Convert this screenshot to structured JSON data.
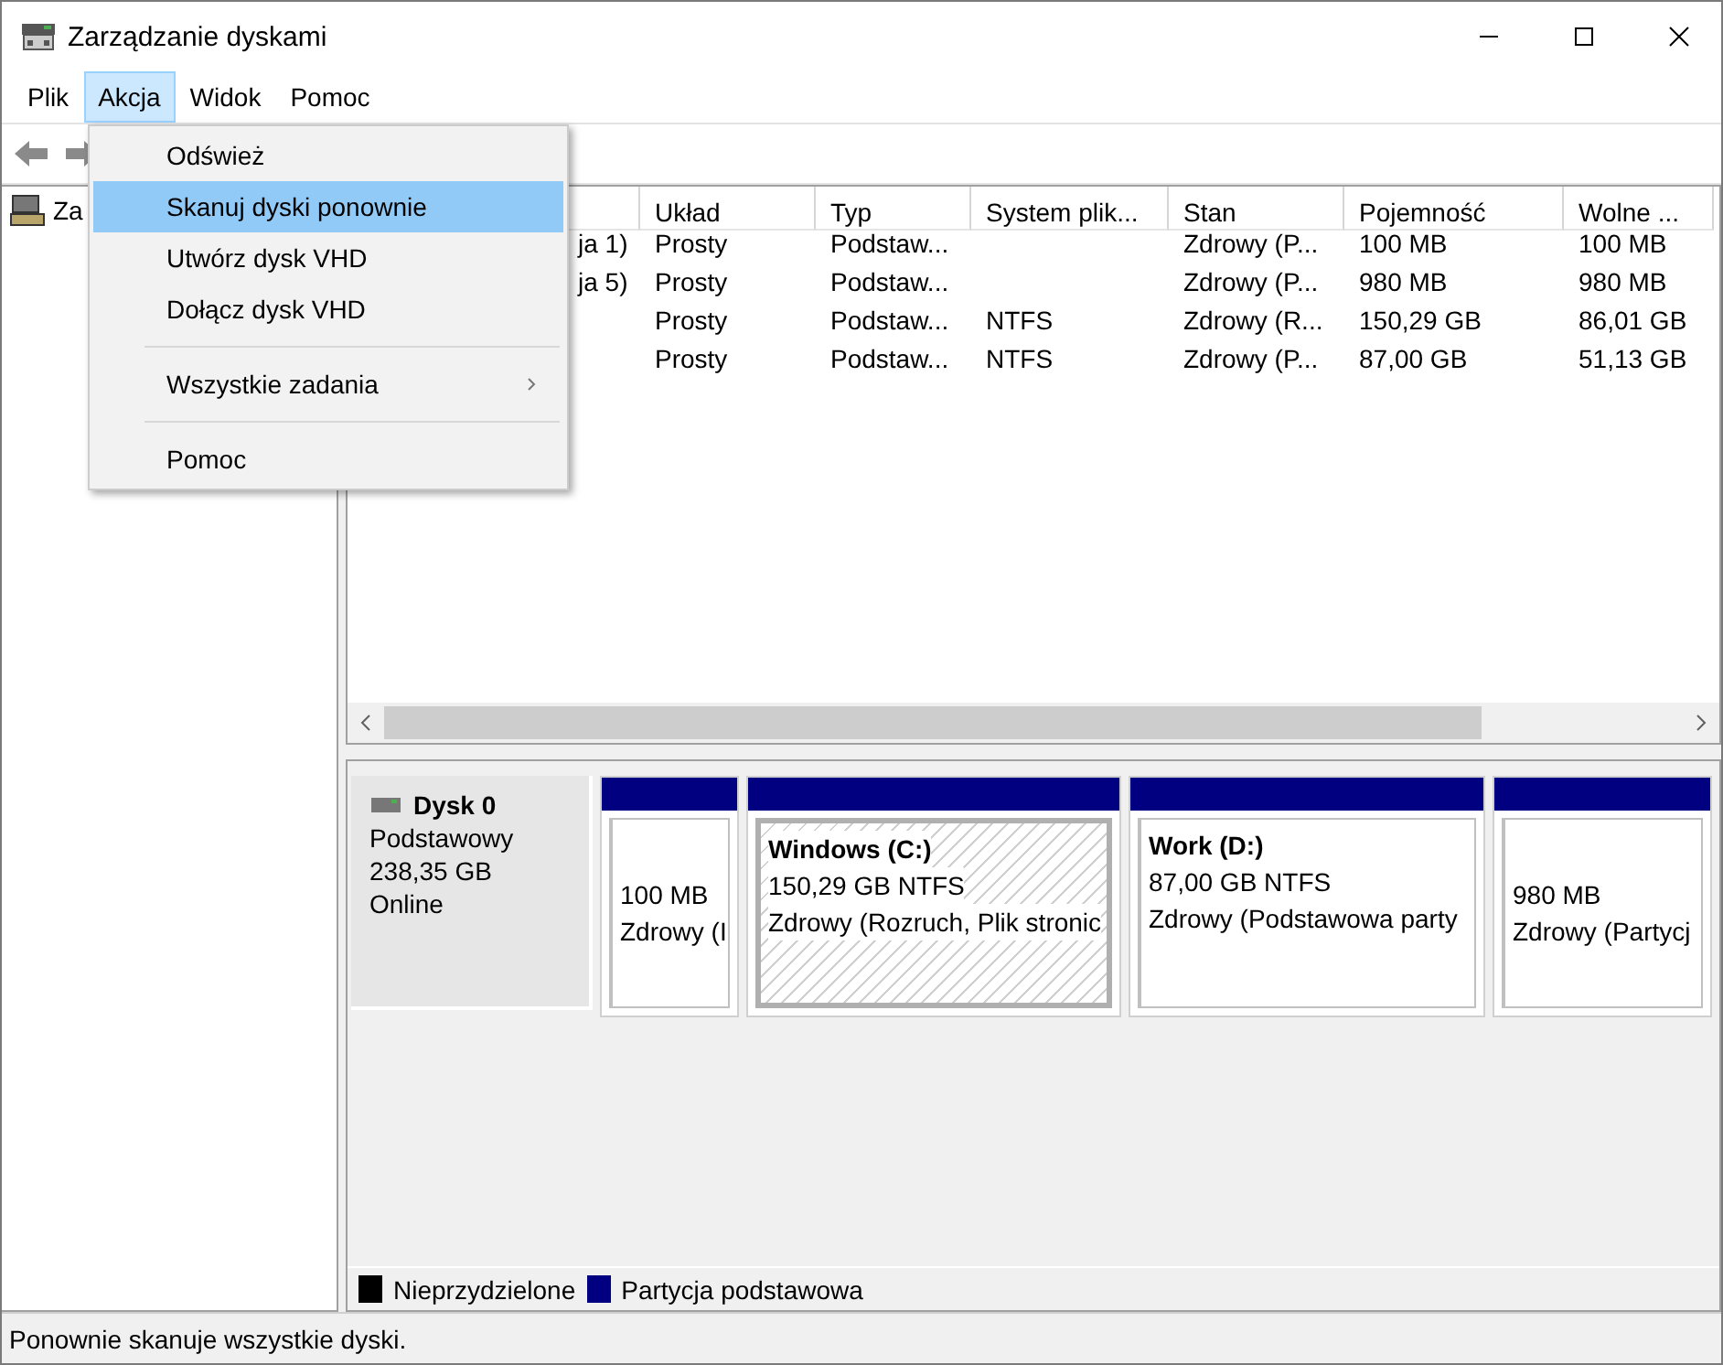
{
  "window": {
    "title": "Zarządzanie dyskami"
  },
  "menubar": [
    {
      "label": "Plik",
      "selected": false
    },
    {
      "label": "Akcja",
      "selected": true
    },
    {
      "label": "Widok",
      "selected": false
    },
    {
      "label": "Pomoc",
      "selected": false
    }
  ],
  "menu": {
    "groups": [
      [
        {
          "label": "Odśwież",
          "kind": "command",
          "selected": false
        },
        {
          "label": "Skanuj dyski ponownie",
          "kind": "command",
          "selected": true
        },
        {
          "label": "Utwórz dysk VHD",
          "kind": "command",
          "selected": false
        },
        {
          "label": "Dołącz dysk VHD",
          "kind": "command",
          "selected": false
        }
      ],
      [
        {
          "label": "Wszystkie zadania",
          "kind": "submenu",
          "selected": false
        }
      ],
      [
        {
          "label": "Pomoc",
          "kind": "command",
          "selected": false
        }
      ]
    ]
  },
  "tree": {
    "items": [
      {
        "label": "Za",
        "selected": false
      }
    ]
  },
  "volumes": {
    "columns": [
      "",
      "Układ",
      "Typ",
      "System plik...",
      "Stan",
      "Pojemność",
      "Wolne ..."
    ],
    "rows": [
      [
        "ja 1)",
        "Prosty",
        "Podstaw...",
        "",
        "Zdrowy (P...",
        "100 MB",
        "100 MB"
      ],
      [
        "ja 5)",
        "Prosty",
        "Podstaw...",
        "",
        "Zdrowy (P...",
        "980 MB",
        "980 MB"
      ],
      [
        "",
        "Prosty",
        "Podstaw...",
        "NTFS",
        "Zdrowy (R...",
        "150,29 GB",
        "86,01 GB"
      ],
      [
        "",
        "Prosty",
        "Podstaw...",
        "NTFS",
        "Zdrowy (P...",
        "87,00 GB",
        "51,13 GB"
      ]
    ]
  },
  "disk": {
    "name": "Dysk 0",
    "type": "Podstawowy",
    "size": "238,35 GB",
    "status": "Online",
    "partitions": [
      {
        "kind": "primary",
        "selected": false,
        "lines": [
          "100 MB",
          "Zdrowy (I"
        ]
      },
      {
        "kind": "primary",
        "selected": true,
        "name": "Windows  (C:)",
        "lines": [
          "150,29 GB NTFS",
          "Zdrowy (Rozruch, Plik stronic"
        ]
      },
      {
        "kind": "primary",
        "selected": false,
        "name": "Work  (D:)",
        "lines": [
          "87,00 GB NTFS",
          "Zdrowy (Podstawowa party"
        ]
      },
      {
        "kind": "primary",
        "selected": false,
        "lines": [
          "980 MB",
          "Zdrowy (Partycj"
        ]
      }
    ]
  },
  "legend": [
    {
      "label": "Nieprzydzielone",
      "color": "#000000"
    },
    {
      "label": "Partycja podstawowa",
      "color": "#000080"
    }
  ],
  "status_bar": "Ponownie skanuje wszystkie dyski."
}
